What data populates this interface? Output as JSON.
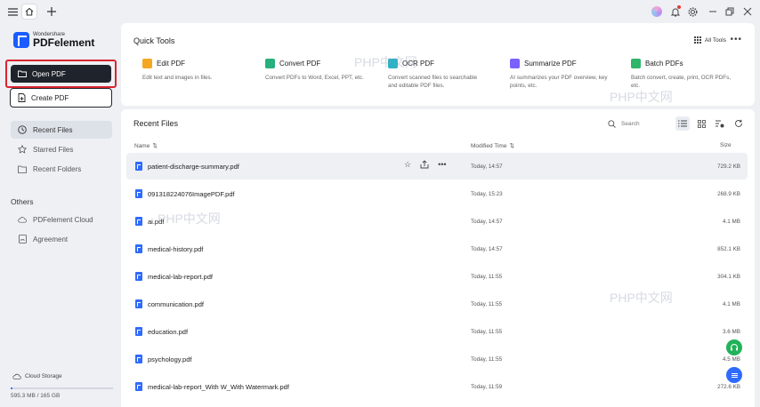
{
  "titlebar": {
    "icons": [
      "menu-icon",
      "home-icon",
      "plus-icon",
      "avatar",
      "bell-icon",
      "gear-icon",
      "minimize-icon",
      "restore-icon",
      "close-icon"
    ]
  },
  "sidebar": {
    "logo_small": "Wondershare",
    "logo_big": "PDFelement",
    "open_pdf": "Open PDF",
    "create_pdf": "Create PDF",
    "nav": [
      "Recent Files",
      "Starred Files",
      "Recent Folders"
    ],
    "others_title": "Others",
    "others": [
      "PDFelement Cloud",
      "Agreement"
    ],
    "cloud_storage": "Cloud Storage",
    "storage_used": "595.3 MB / 165 GB",
    "storage_fraction": 0.004
  },
  "quick_tools": {
    "title": "Quick Tools",
    "all_tools": "All Tools",
    "tools": [
      {
        "name": "Edit PDF",
        "desc": "Edit text and images in files.",
        "color": "#f5a623"
      },
      {
        "name": "Convert PDF",
        "desc": "Convert PDFs to Word, Excel, PPT, etc.",
        "color": "#27b07d"
      },
      {
        "name": "OCR PDF",
        "desc": "Convert scanned files to searchable and editable PDF files.",
        "color": "#2bb3c7"
      },
      {
        "name": "Summarize PDF",
        "desc": "AI summarizes your PDF overview, key points, etc.",
        "color": "#7b61ff"
      },
      {
        "name": "Batch PDFs",
        "desc": "Batch convert, create, print, OCR PDFs, etc.",
        "color": "#2fb56a"
      }
    ]
  },
  "recent": {
    "title": "Recent Files",
    "search_placeholder": "Search",
    "col_name": "Name",
    "col_modified": "Modified Time",
    "col_size": "Size",
    "files": [
      {
        "name": "patient-discharge-summary.pdf",
        "date": "Today, 14:57",
        "size": "729.2 KB"
      },
      {
        "name": "091318224076ImagePDF.pdf",
        "date": "Today, 15:23",
        "size": "268.9 KB"
      },
      {
        "name": "ai.pdf",
        "date": "Today, 14:57",
        "size": "4.1 MB"
      },
      {
        "name": "medical-history.pdf",
        "date": "Today, 14:57",
        "size": "852.1 KB"
      },
      {
        "name": "medical-lab-report.pdf",
        "date": "Today, 11:55",
        "size": "304.1 KB"
      },
      {
        "name": "communication.pdf",
        "date": "Today, 11:55",
        "size": "4.1 MB"
      },
      {
        "name": "education.pdf",
        "date": "Today, 11:55",
        "size": "3.6 MB"
      },
      {
        "name": "psychology.pdf",
        "date": "Today, 11:55",
        "size": "4.5 MB"
      },
      {
        "name": "medical-lab-report_With W_With Watermark.pdf",
        "date": "Today, 11:59",
        "size": "272.6 KB"
      }
    ]
  },
  "watermarks": [
    "PHP中文网",
    "PHP中文网",
    "PHP中文网",
    "PHP中文网"
  ],
  "colors": {
    "accent": "#2f6bff",
    "dark_button": "#1f232b",
    "highlight_border": "#d9242f"
  }
}
